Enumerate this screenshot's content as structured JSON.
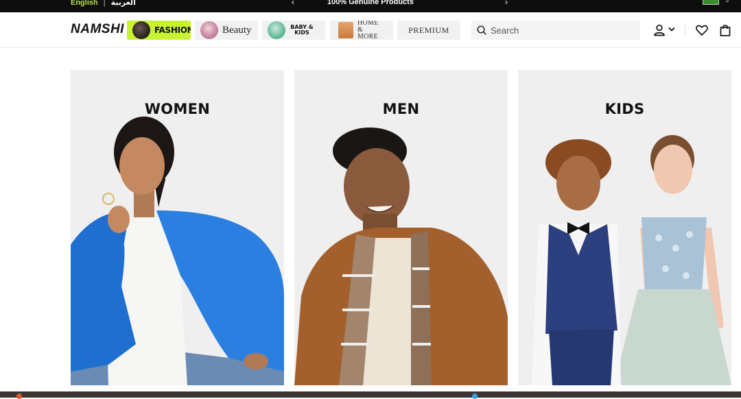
{
  "topbar": {
    "lang_english": "English",
    "lang_separator": "|",
    "lang_arabic": "العربية",
    "promo_text": "100% Genuine Products",
    "prev_arrow": "‹",
    "next_arrow": "›"
  },
  "header": {
    "logo": "NAMSHI",
    "tabs": [
      {
        "label": "FASHION",
        "active": true
      },
      {
        "label": "Beauty",
        "active": false
      },
      {
        "label": "BABY & KIDS",
        "active": false
      },
      {
        "label": "HOME & MORE",
        "active": false
      },
      {
        "label": "PREMIUM",
        "active": false
      }
    ],
    "search_placeholder": "Search",
    "icons": [
      "user-icon",
      "chevron-down-icon",
      "heart-icon",
      "bag-icon"
    ]
  },
  "categories": [
    {
      "title": "WOMEN"
    },
    {
      "title": "MEN"
    },
    {
      "title": "KIDS"
    }
  ],
  "colors": {
    "accent_green": "#c7f332",
    "topbar_bg": "#0e0e0e",
    "card_bg": "#efefef"
  }
}
